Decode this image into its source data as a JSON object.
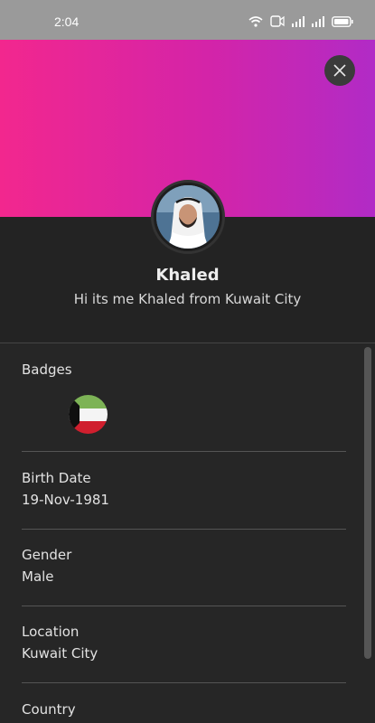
{
  "status_bar": {
    "time": "2:04",
    "icons": [
      "wifi-icon",
      "volte-icon",
      "signal-icon",
      "signal-icon",
      "battery-icon"
    ]
  },
  "header": {
    "gradient_colors": [
      "#f2278e",
      "#b12bc6"
    ],
    "close_icon": "close-icon"
  },
  "profile": {
    "name": "Khaled",
    "bio": "Hi its me Khaled from Kuwait City"
  },
  "details": {
    "badges_label": "Badges",
    "badges": [
      {
        "icon": "kuwait-flag-icon"
      }
    ],
    "birth_date_label": "Birth Date",
    "birth_date": "19-Nov-1981",
    "gender_label": "Gender",
    "gender": "Male",
    "location_label": "Location",
    "location": "Kuwait City",
    "country_label": "Country"
  }
}
